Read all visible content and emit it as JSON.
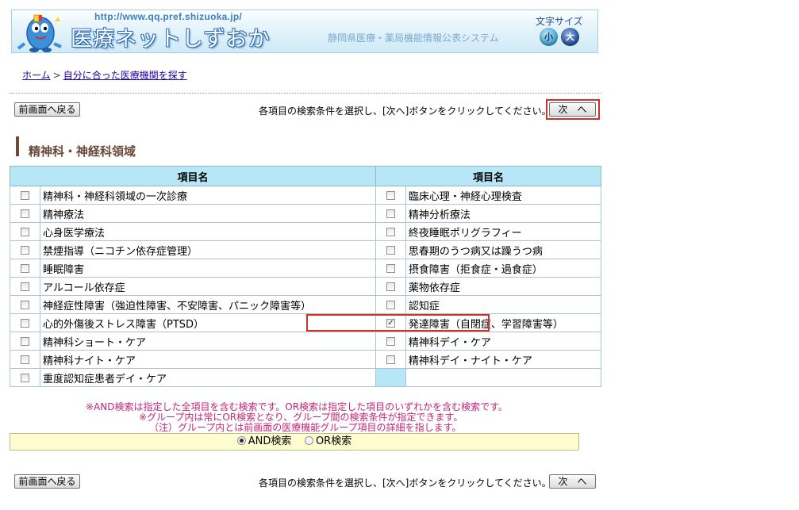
{
  "header": {
    "url_text": "http://www.qq.pref.shizuoka.jp/",
    "site_title": "医療ネットしずおか",
    "subtitle": "静岡県医療・薬局機能情報公表システム",
    "font_size_label": "文字サイズ",
    "font_small": "小",
    "font_large": "大"
  },
  "breadcrumb": {
    "home": "ホーム",
    "current": "自分に合った医療機関を探す"
  },
  "toolbar": {
    "back_label": "前画面へ戻る",
    "instruction": "各項目の検索条件を選択し、[次へ]ボタンをクリックしてください。→",
    "next_label": "次　へ"
  },
  "section": {
    "title": "精神科・神経科領域"
  },
  "table": {
    "headers": [
      "項目名",
      "項目名"
    ],
    "rows": [
      [
        {
          "label": "精神科・神経科領域の一次診療",
          "checked": false
        },
        {
          "label": "臨床心理・神経心理検査",
          "checked": false
        }
      ],
      [
        {
          "label": "精神療法",
          "checked": false
        },
        {
          "label": "精神分析療法",
          "checked": false
        }
      ],
      [
        {
          "label": "心身医学療法",
          "checked": false
        },
        {
          "label": "終夜睡眠ポリグラフィー",
          "checked": false
        }
      ],
      [
        {
          "label": "禁煙指導（ニコチン依存症管理）",
          "checked": false
        },
        {
          "label": "思春期のうつ病又は躁うつ病",
          "checked": false
        }
      ],
      [
        {
          "label": "睡眠障害",
          "checked": false
        },
        {
          "label": "摂食障害（拒食症・過食症）",
          "checked": false
        }
      ],
      [
        {
          "label": "アルコール依存症",
          "checked": false
        },
        {
          "label": "薬物依存症",
          "checked": false
        }
      ],
      [
        {
          "label": "神経症性障害（強迫性障害、不安障害、パニック障害等）",
          "checked": false
        },
        {
          "label": "認知症",
          "checked": false
        }
      ],
      [
        {
          "label": "心的外傷後ストレス障害（PTSD）",
          "checked": false
        },
        {
          "label": "発達障害（自閉症、学習障害等）",
          "checked": true
        }
      ],
      [
        {
          "label": "精神科ショート・ケア",
          "checked": false
        },
        {
          "label": "精神科デイ・ケア",
          "checked": false
        }
      ],
      [
        {
          "label": "精神科ナイト・ケア",
          "checked": false
        },
        {
          "label": "精神科デイ・ナイト・ケア",
          "checked": false
        }
      ],
      [
        {
          "label": "重度認知症患者デイ・ケア",
          "checked": false
        },
        null
      ]
    ]
  },
  "notes": [
    "※AND検索は指定した全項目を含む検索です。OR検索は指定した項目のいずれかを含む検索です。",
    "※グループ内は常にOR検索となり、グループ間の検索条件が指定できます。",
    "（注）グループ内とは前画面の医療機能グループ項目の詳細を指します。"
  ],
  "search_mode": {
    "and_label": "AND検索",
    "or_label": "OR検索",
    "selected": "AND"
  },
  "colors": {
    "table_header": "#b7e7f7",
    "note_text": "#c0267a",
    "highlight": "#d0302a",
    "section_title": "#6b4a3a"
  }
}
